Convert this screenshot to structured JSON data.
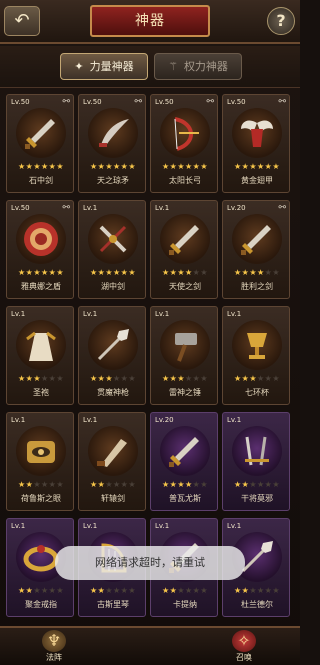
{
  "header": {
    "title": "神器",
    "back_icon": "back-arrow-icon",
    "help_label": "?"
  },
  "tabs": [
    {
      "label": "力量神器",
      "icon": "sword-icon",
      "active": true
    },
    {
      "label": "权力神器",
      "icon": "scepter-icon",
      "active": false
    }
  ],
  "artifacts": [
    {
      "level": "Lv.50",
      "name": "石中剑",
      "stars": 6,
      "max_stars": 6,
      "bound": true,
      "theme": "gold",
      "icon": "sword-icon"
    },
    {
      "level": "Lv.50",
      "name": "天之琼矛",
      "stars": 6,
      "max_stars": 6,
      "bound": true,
      "theme": "gold",
      "icon": "curved-blade-icon"
    },
    {
      "level": "Lv.50",
      "name": "太阳长弓",
      "stars": 6,
      "max_stars": 6,
      "bound": true,
      "theme": "gold",
      "icon": "bow-icon"
    },
    {
      "level": "Lv.50",
      "name": "黄金翅甲",
      "stars": 6,
      "max_stars": 6,
      "bound": true,
      "theme": "gold",
      "icon": "winged-armor-icon"
    },
    {
      "level": "Lv.50",
      "name": "雅典娜之盾",
      "stars": 6,
      "max_stars": 6,
      "bound": true,
      "theme": "gold",
      "icon": "shield-icon"
    },
    {
      "level": "Lv.1",
      "name": "湖中剑",
      "stars": 6,
      "max_stars": 6,
      "bound": false,
      "theme": "gold",
      "icon": "crossed-sword-icon"
    },
    {
      "level": "Lv.1",
      "name": "天使之剑",
      "stars": 4,
      "max_stars": 6,
      "bound": false,
      "theme": "gold",
      "icon": "sword-icon"
    },
    {
      "level": "Lv.20",
      "name": "胜利之剑",
      "stars": 4,
      "max_stars": 6,
      "bound": true,
      "theme": "gold",
      "icon": "sword-icon"
    },
    {
      "level": "Lv.1",
      "name": "圣袍",
      "stars": 3,
      "max_stars": 6,
      "bound": false,
      "theme": "gold",
      "icon": "robe-icon"
    },
    {
      "level": "Lv.1",
      "name": "贯魔神枪",
      "stars": 3,
      "max_stars": 6,
      "bound": false,
      "theme": "gold",
      "icon": "spear-icon"
    },
    {
      "level": "Lv.1",
      "name": "雷神之锤",
      "stars": 3,
      "max_stars": 6,
      "bound": false,
      "theme": "gold",
      "icon": "hammer-icon"
    },
    {
      "level": "Lv.1",
      "name": "七环杯",
      "stars": 3,
      "max_stars": 6,
      "bound": false,
      "theme": "gold",
      "icon": "grail-icon"
    },
    {
      "level": "Lv.1",
      "name": "荷鲁斯之眼",
      "stars": 2,
      "max_stars": 6,
      "bound": false,
      "theme": "gold",
      "icon": "eye-icon"
    },
    {
      "level": "Lv.1",
      "name": "轩辕剑",
      "stars": 2,
      "max_stars": 6,
      "bound": false,
      "theme": "gold",
      "icon": "broad-sword-icon"
    },
    {
      "level": "Lv.20",
      "name": "普瓦尤斯",
      "stars": 4,
      "max_stars": 6,
      "bound": false,
      "theme": "purple",
      "icon": "sword-icon"
    },
    {
      "level": "Lv.1",
      "name": "干将莫邪",
      "stars": 2,
      "max_stars": 6,
      "bound": false,
      "theme": "purple",
      "icon": "twin-sword-icon"
    },
    {
      "level": "Lv.1",
      "name": "聚金戒指",
      "stars": 2,
      "max_stars": 6,
      "bound": false,
      "theme": "purple",
      "icon": "ring-icon"
    },
    {
      "level": "Lv.1",
      "name": "古斯里琴",
      "stars": 2,
      "max_stars": 6,
      "bound": false,
      "theme": "purple",
      "icon": "harp-icon"
    },
    {
      "level": "Lv.1",
      "name": "卡提纳",
      "stars": 2,
      "max_stars": 6,
      "bound": false,
      "theme": "purple",
      "icon": "sword-icon"
    },
    {
      "level": "Lv.1",
      "name": "杜兰德尔",
      "stars": 2,
      "max_stars": 6,
      "bound": false,
      "theme": "purple",
      "icon": "spear-icon"
    }
  ],
  "toast": "网络请求超时，请重试",
  "bottom_nav": [
    {
      "label": "法阵",
      "icon": "magic-circle-icon"
    },
    {
      "label": "召唤",
      "icon": "summon-icon"
    }
  ],
  "colors": {
    "star": "#f7c64a",
    "banner": "#8f231f",
    "gold_theme": "#5f3b1f",
    "purple_theme": "#5b2f70"
  }
}
